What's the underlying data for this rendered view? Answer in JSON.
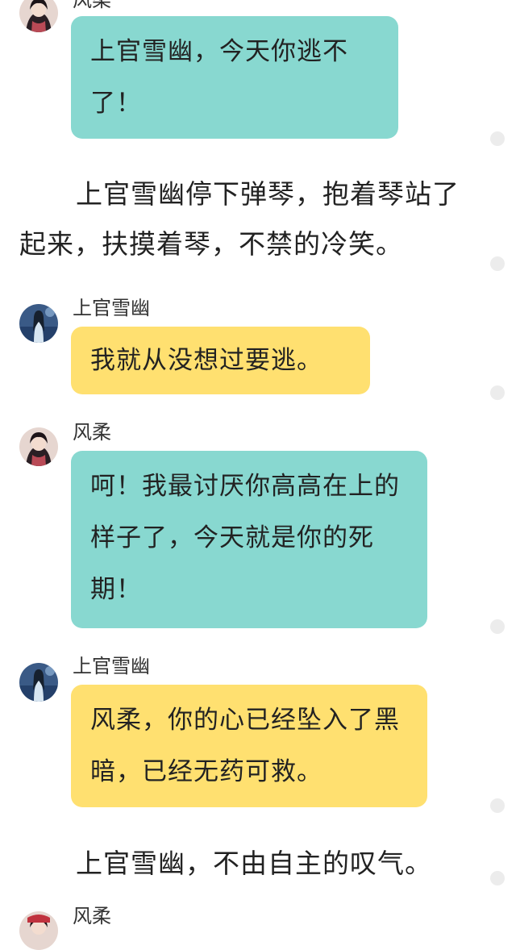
{
  "speakers": {
    "fengrou": "风柔",
    "shangguan": "上官雪幽"
  },
  "messages": [
    {
      "speaker": "风柔",
      "text": "上官雪幽，今天你逃不了！"
    },
    {
      "speaker": "上官雪幽",
      "text": "我就从没想过要逃。"
    },
    {
      "speaker": "风柔",
      "text": "呵！我最讨厌你高高在上的样子了，今天就是你的死期！"
    },
    {
      "speaker": "上官雪幽",
      "text": "风柔，你的心已经坠入了黑暗，已经无药可救。"
    },
    {
      "speaker": "风柔",
      "text": ""
    }
  ],
  "narrations": [
    "上官雪幽停下弹琴，抱着琴站了起来，扶摸着琴，不禁的冷笑。",
    "上官雪幽，不由自主的叹气。"
  ],
  "colors": {
    "fengrou_bubble": "#88d8d0",
    "shangguan_bubble": "#ffe070",
    "scroll_dot": "#ececec"
  }
}
